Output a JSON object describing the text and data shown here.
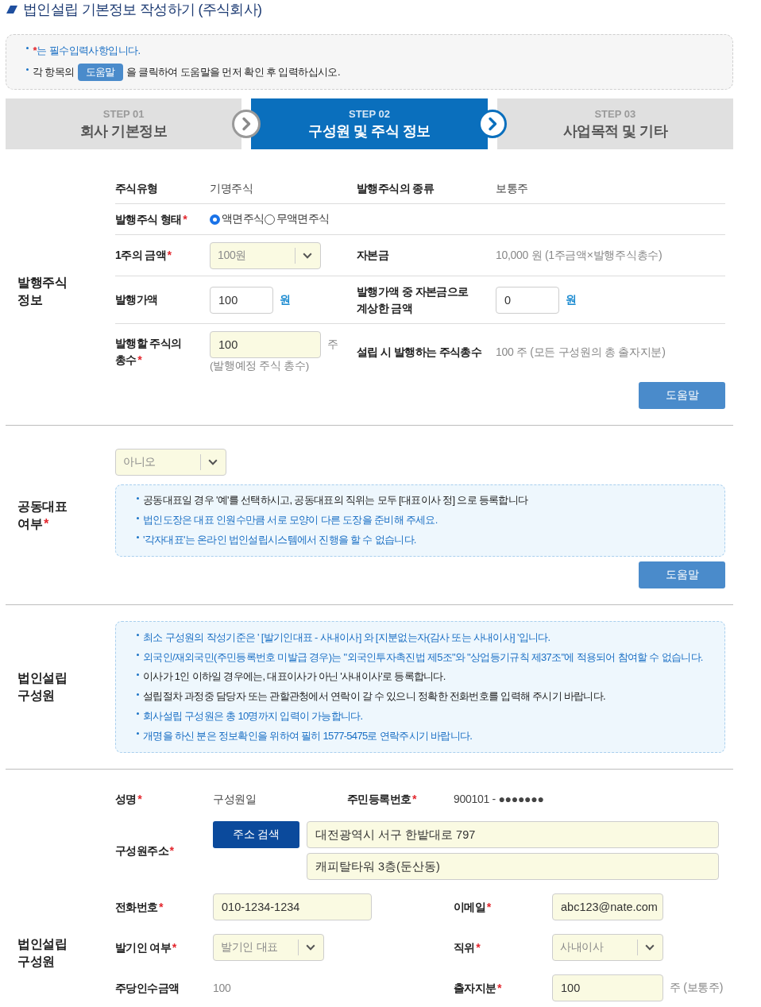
{
  "title": "법인설립 기본정보 작성하기 (주식회사)",
  "notice": [
    {
      "kind": "required",
      "mark": "*",
      "text": "는 필수입력사항입니다.",
      "highlighted": true
    },
    {
      "kind": "help",
      "before": "각 항목의",
      "badge": "도움말",
      "after": "을 클릭하여 도움말을 먼저 확인 후 입력하십시오.",
      "highlighted": false
    }
  ],
  "steps": [
    {
      "step": "STEP 01",
      "title": "회사 기본정보",
      "selected": false
    },
    {
      "step": "STEP 02",
      "title": "구성원 및 주식 정보",
      "selected": true
    },
    {
      "step": "STEP 03",
      "title": "사업목적 및 기타",
      "selected": false
    }
  ],
  "sections": [
    {
      "kind": "fields",
      "label": "발행주식 정보",
      "rows": [
        {
          "kind": "pair",
          "cells": [
            {
              "label": "주식유형",
              "value": {
                "kind": "text",
                "text": "기명주식",
                "muted": false
              }
            },
            {
              "label": "발행주식의 종류",
              "value": {
                "kind": "text",
                "text": "보통주",
                "muted": false
              }
            }
          ]
        },
        {
          "kind": "pair",
          "cells": [
            {
              "label": "발행주식 형태",
              "required_mark": "*",
              "value": {
                "kind": "radio",
                "options": [
                  {
                    "label": "액면주식",
                    "selected": true
                  },
                  {
                    "label": "무액면주식",
                    "selected": false
                  }
                ]
              }
            }
          ]
        },
        {
          "kind": "pair",
          "cells": [
            {
              "label": "1주의 금액",
              "required_mark": "*",
              "value": {
                "kind": "select",
                "text": "100원",
                "highlighted": true
              }
            },
            {
              "label": "자본금",
              "value": {
                "kind": "text",
                "text": "10,000 원 (1주금액×발행주식총수)",
                "muted": true
              }
            }
          ]
        },
        {
          "kind": "pair",
          "cells": [
            {
              "label": "발행가액",
              "value": {
                "kind": "input",
                "text": "100",
                "highlighted": false,
                "unit": {
                  "text": "원",
                  "highlighted": true
                }
              }
            },
            {
              "label": "발행가액 중 자본금으로 계상한 금액",
              "value": {
                "kind": "input",
                "text": "0",
                "highlighted": false,
                "unit": {
                  "text": "원",
                  "highlighted": true
                }
              }
            }
          ]
        },
        {
          "kind": "pair",
          "cells": [
            {
              "label": "발행할 주식의 총수",
              "required_mark": "*",
              "value": {
                "kind": "input",
                "text": "100",
                "highlighted": true,
                "unit": {
                  "text": "주",
                  "highlighted": false
                },
                "hint": "(발행예정 주식 총수)"
              }
            },
            {
              "label": "설립 시 발행하는 주식총수",
              "value": {
                "kind": "text",
                "text": "100 주 (모든 구성원의 총 출자지분)",
                "muted": true
              }
            }
          ]
        }
      ],
      "help_button": "도움말"
    },
    {
      "kind": "notice",
      "label": "공동대표 여부",
      "required_mark": "*",
      "select": {
        "text": "아니오",
        "highlighted": true
      },
      "lines": [
        {
          "text": "공동대표일 경우 '예'를 선택하시고, 공동대표의 직위는 모두 [대표이사 정] 으로 등록합니다",
          "highlighted": false
        },
        {
          "text": "법인도장은 대표 인원수만큼 서로 모양이 다른 도장을 준비해 주세요.",
          "highlighted": true
        },
        {
          "text": "'각자대표'는 온라인 법인설립시스템에서 진행을 할 수 없습니다.",
          "highlighted": true
        }
      ],
      "help_button": "도움말"
    },
    {
      "kind": "notice",
      "label": "법인설립 구성원",
      "lines": [
        {
          "text": "최소 구성원의 작성기준은 ' [발기인대표 - 사내이사] 와 [지분없는자(감사 또는 사내이사] '입니다.",
          "highlighted": true
        },
        {
          "text": "외국인/재외국민(주민등록번호 미발급 경우)는 \"외국인투자촉진법 제5조\"와 \"상업등기규칙 제37조\"에 적용되어 참여할 수 없습니다.",
          "highlighted": true
        },
        {
          "text": "이사가 1인 이하일 경우에는, 대표이사가 아닌 '사내이사'로 등록합니다.",
          "highlighted": false
        },
        {
          "text": "설립절차 과정중 담당자 또는 관할관청에서 연락이 갈 수 있으니 정확한 전화번호를 입력해 주시기 바랍니다.",
          "highlighted": false
        },
        {
          "text": "회사설립 구성원은 총 10명까지 입력이 가능합니다.",
          "highlighted": true
        },
        {
          "text": "개명을 하신 분은 정보확인을 위하여 필히 1577-5475로 연락주시기 바랍니다.",
          "highlighted": true
        }
      ]
    },
    {
      "kind": "member",
      "label": "법인설립 구성원",
      "rows": [
        {
          "kind": "compact",
          "cells": [
            {
              "label": "성명",
              "required_mark": "*",
              "value": {
                "kind": "text",
                "text": "구성원일",
                "muted": false
              }
            },
            {
              "label": "주민등록번호",
              "required_mark": "*",
              "value": {
                "kind": "text",
                "text": "900101 - ●●●●●●●",
                "muted": false
              }
            }
          ]
        },
        {
          "kind": "address",
          "label": "구성원주소",
          "required_mark": "*",
          "button": "주소 검색",
          "lines": [
            {
              "text": "대전광역시 서구 한밭대로 797",
              "highlighted": true
            },
            {
              "text": "캐피탈타워 3층(둔산동)",
              "highlighted": true
            }
          ]
        },
        {
          "kind": "pair",
          "cells": [
            {
              "label": "전화번호",
              "required_mark": "*",
              "value": {
                "kind": "input",
                "text": "010-1234-1234",
                "highlighted": true
              }
            },
            {
              "label": "이메일",
              "required_mark": "*",
              "value": {
                "kind": "input",
                "text": "abc123@nate.com",
                "highlighted": true
              }
            }
          ]
        },
        {
          "kind": "pair",
          "cells": [
            {
              "label": "발기인 여부",
              "required_mark": "*",
              "value": {
                "kind": "select",
                "text": "발기인 대표",
                "highlighted": true
              }
            },
            {
              "label": "직위",
              "required_mark": "*",
              "value": {
                "kind": "select",
                "text": "사내이사",
                "highlighted": true
              }
            }
          ]
        },
        {
          "kind": "pair",
          "cells": [
            {
              "label": "주당인수금액",
              "value": {
                "kind": "text",
                "text": "100",
                "muted": true
              }
            },
            {
              "label": "출자지분",
              "required_mark": "*",
              "value": {
                "kind": "input",
                "text": "100",
                "highlighted": true,
                "unit": {
                  "text": "주 (보통주)",
                  "highlighted": false
                }
              }
            }
          ]
        }
      ]
    }
  ]
}
